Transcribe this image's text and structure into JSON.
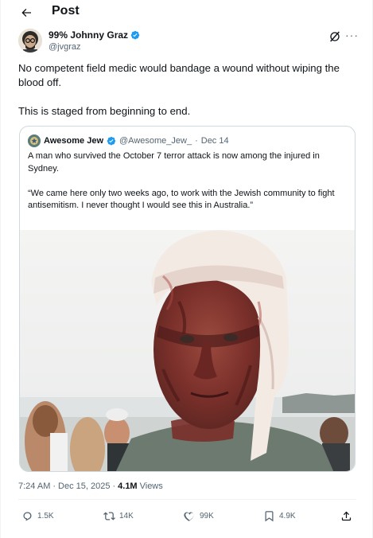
{
  "header": {
    "title": "Post"
  },
  "author": {
    "name": "99% Johnny Graz",
    "handle": "@jvgraz"
  },
  "tweet": {
    "paragraphs": [
      "No competent field medic would bandage a wound without wiping the blood off.",
      "This is staged from beginning to end."
    ]
  },
  "quote": {
    "name": "Awesome Jew",
    "handle": "@Awesome_Jew_",
    "separator": "·",
    "date": "Dec 14",
    "paragraphs": [
      "A man who survived the October 7 terror attack is now among the injured in Sydney.",
      "“We came here only two weeks ago, to work with the Jewish community to fight antisemitism. I never thought I would see this in Australia.”"
    ]
  },
  "meta": {
    "time": "7:24 AM",
    "date": "Dec 15, 2025",
    "separator": "·",
    "views_count": "4.1M",
    "views_label": "Views"
  },
  "actions": {
    "replies": "1.5K",
    "reposts": "14K",
    "likes": "99K",
    "bookmarks": "4.9K"
  },
  "colors": {
    "verified": "#1d9bf0",
    "muted": "#536471",
    "text": "#0f1419",
    "border": "#cfd9de"
  },
  "icons": [
    "back-arrow-icon",
    "verified-badge-icon",
    "grok-icon",
    "more-icon",
    "reply-icon",
    "repost-icon",
    "like-icon",
    "bookmark-icon",
    "share-icon"
  ]
}
